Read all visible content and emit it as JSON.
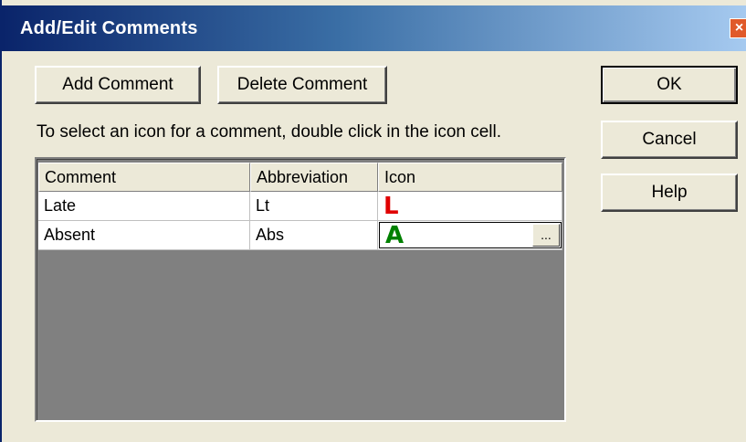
{
  "window": {
    "title": "Add/Edit Comments",
    "close_label": "×"
  },
  "toolbar": {
    "add_label": "Add Comment",
    "delete_label": "Delete Comment"
  },
  "side_buttons": {
    "ok_label": "OK",
    "cancel_label": "Cancel",
    "help_label": "Help"
  },
  "instruction": "To select an icon for a comment, double click in the icon cell.",
  "table": {
    "columns": [
      "Comment",
      "Abbreviation",
      "Icon"
    ],
    "rows": [
      {
        "comment": "Late",
        "abbreviation": "Lt",
        "icon": "L",
        "icon_color": "#e00000"
      },
      {
        "comment": "Absent",
        "abbreviation": "Abs",
        "icon": "A",
        "icon_color": "#008000"
      }
    ],
    "browse_label": "..."
  },
  "colors": {
    "title_bar_start": "#0a246a",
    "title_bar_end": "#a6caf0",
    "dialog_background": "#ece9d8",
    "grid_empty_area": "#808080"
  }
}
